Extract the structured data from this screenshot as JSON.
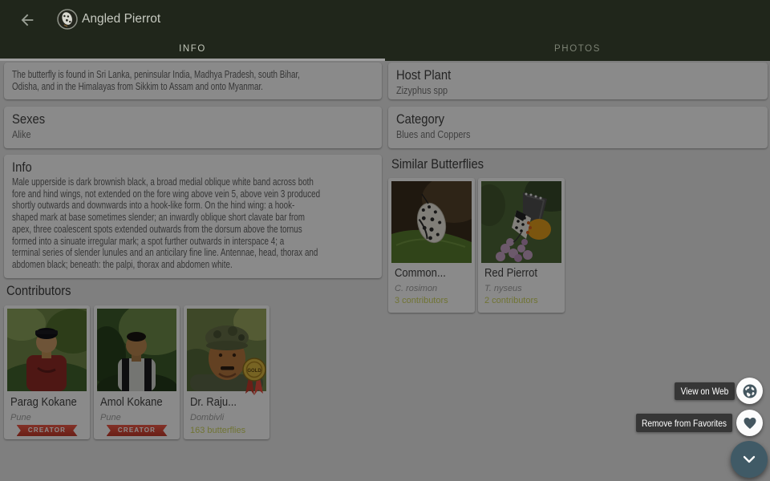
{
  "header": {
    "title": "Angled Pierrot",
    "back_icon": "arrow-left-icon",
    "avatar_icon": "butterfly-thumbnail"
  },
  "tabs": [
    {
      "label": "INFO",
      "active": true
    },
    {
      "label": "PHOTOS",
      "active": false
    }
  ],
  "left_column": {
    "distribution_text": "The butterfly is found in Sri Lanka, peninsular India, Madhya Pradesh, south Bihar,\nOdisha, and in the Himalayas from Sikkim to Assam and onto Myanmar.",
    "sexes": {
      "title": "Sexes",
      "value": "Alike"
    },
    "info": {
      "title": "Info",
      "text": "Male upperside is dark brownish black, a broad medial oblique white band across both\nfore and hind wings, not extended on the fore wing above vein 5, above vein 3 produced\nshortly outwards and downwards into a hook-like form. On the hind wing: a hook-\nshaped mark at base sometimes slender; an inwardly oblique short clavate bar from\napex, three coalescent spots extended outwards from the dorsum above the tornus\nformed into a sinuate irregular mark; a spot further outwards in interspace 4; a\nterminal series of slender lunules and an anticilary fine line. Antennae, head, thorax and\nabdomen black; beneath: the palpi, thorax and abdomen white."
    },
    "contributors": {
      "heading": "Contributors",
      "cards": [
        {
          "name": "Parag Kokane",
          "location": "Pune",
          "badge": "CREATOR"
        },
        {
          "name": "Amol Kokane",
          "location": "Pune",
          "badge": "CREATOR"
        },
        {
          "name": "Dr. Raju...",
          "location": "Dombivli",
          "stat": "163 butterflies",
          "medal": "gold-medal"
        }
      ]
    }
  },
  "right_column": {
    "host_plant": {
      "title": "Host Plant",
      "value": "Zizyphus spp"
    },
    "category": {
      "title": "Category",
      "value": "Blues and Coppers"
    },
    "similar": {
      "heading": "Similar Butterflies",
      "cards": [
        {
          "name": "Common...",
          "species": "C. rosimon",
          "contributors": "3 contributors"
        },
        {
          "name": "Red Pierrot",
          "species": "T. nyseus",
          "contributors": "2 contributors"
        }
      ]
    }
  },
  "fab_menu": {
    "actions": [
      {
        "label": "View on Web",
        "icon": "globe-icon"
      },
      {
        "label": "Remove from Favorites",
        "icon": "heart-icon"
      }
    ],
    "main_icon": "chevron-down-icon"
  },
  "colors": {
    "header_bg": "#20261b",
    "accent_olive": "#cdd35f",
    "ribbon_red": "#e74c3c",
    "fab_bg": "#405a66",
    "tooltip_bg": "#303030"
  }
}
